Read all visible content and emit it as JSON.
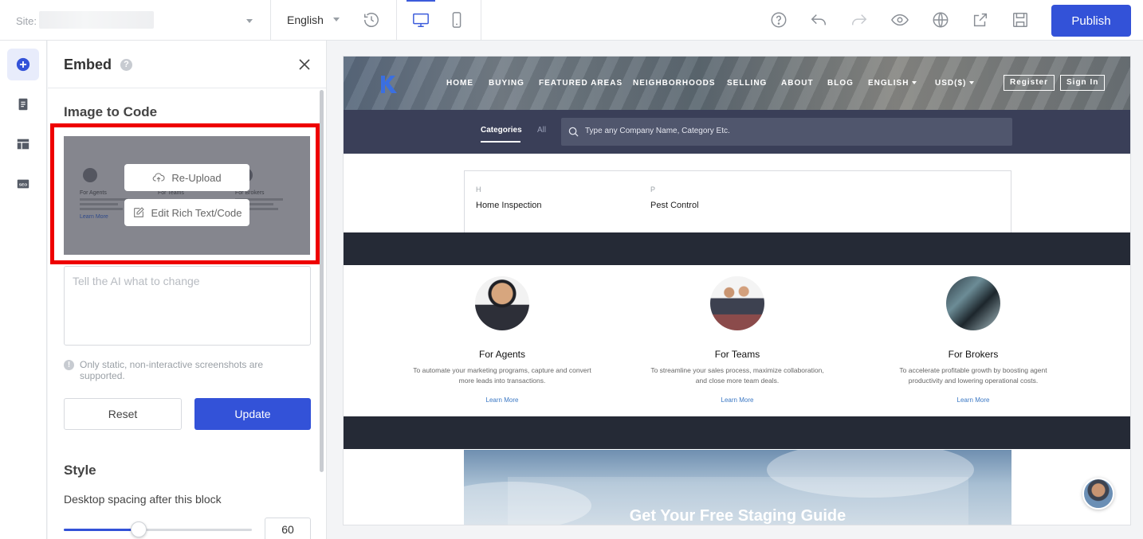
{
  "topbar": {
    "site_label": "Site:",
    "language": "English",
    "publish_label": "Publish"
  },
  "panel": {
    "title": "Embed",
    "help": "?",
    "section_title": "Image to Code",
    "reupload_label": "Re-Upload",
    "edit_label": "Edit Rich Text/Code",
    "thumb_cols": [
      "For Agents",
      "For Teams",
      "For Brokers"
    ],
    "thumb_learn": "Learn More",
    "ai_placeholder": "Tell the AI what to change",
    "note": "Only static, non-interactive screenshots are supported.",
    "note_icon": "!",
    "reset_label": "Reset",
    "update_label": "Update",
    "style_title": "Style",
    "spacing_label": "Desktop spacing after this block",
    "spacing_value": "60",
    "spacing_fraction": 0.4
  },
  "preview": {
    "nav": [
      "HOME",
      "BUYING",
      "FEATURED AREAS",
      "NEIGHBORHOODS",
      "SELLING",
      "ABOUT",
      "BLOG"
    ],
    "lang": "ENGLISH",
    "currency": "USD($)",
    "register": "Register",
    "signin": "Sign In",
    "tab_categories": "Categories",
    "tab_all": "All",
    "search_placeholder": "Type any Company Name, Category Etc.",
    "categories": [
      {
        "letter": "H",
        "name": "Home Inspection"
      },
      {
        "letter": "P",
        "name": "Pest Control"
      }
    ],
    "cards": [
      {
        "title": "For Agents",
        "desc": "To automate your marketing programs, capture and convert more leads into transactions.",
        "link": "Learn More"
      },
      {
        "title": "For Teams",
        "desc": "To streamline your sales process, maximize collaboration, and close more team deals.",
        "link": "Learn More"
      },
      {
        "title": "For Brokers",
        "desc": "To accelerate profitable growth by boosting agent productivity and lowering operational costs.",
        "link": "Learn More"
      }
    ],
    "cta_title": "Get Your Free Staging Guide"
  },
  "colors": {
    "accent": "#3352d8",
    "highlight": "#ee0000",
    "dark_band": "#252a36"
  }
}
